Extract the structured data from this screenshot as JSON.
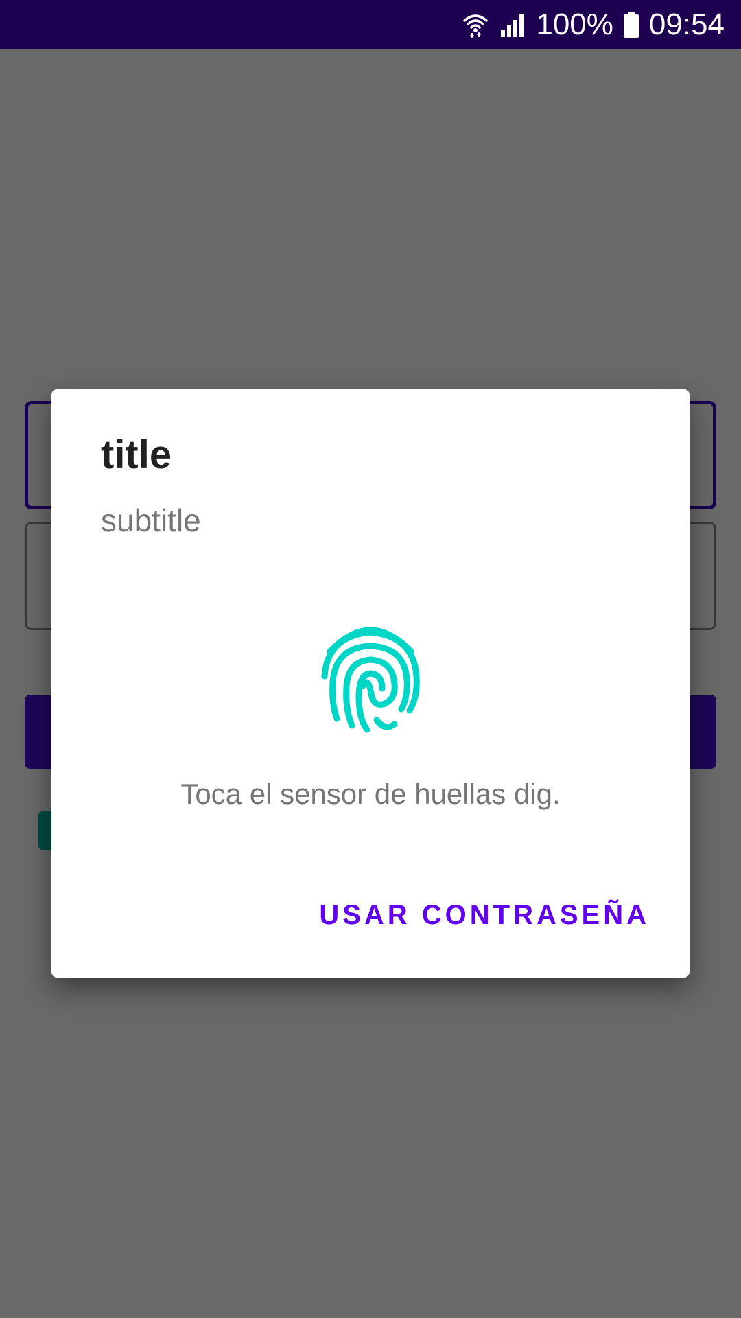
{
  "status_bar": {
    "battery_text": "100%",
    "time": "09:54",
    "icons": [
      "wifi-icon",
      "signal-icon",
      "battery-icon"
    ]
  },
  "dialog": {
    "title": "title",
    "subtitle": "subtitle",
    "icon": "fingerprint-icon",
    "hint": "Toca el sensor de huellas dig.",
    "negative_button": "USAR CONTRASEÑA"
  },
  "colors": {
    "status_bar": "#1e0050",
    "accent": "#6200ee",
    "fingerprint": "#00d6c5",
    "primary_button": "#4a10d8",
    "checkbox": "#00b4a0"
  }
}
